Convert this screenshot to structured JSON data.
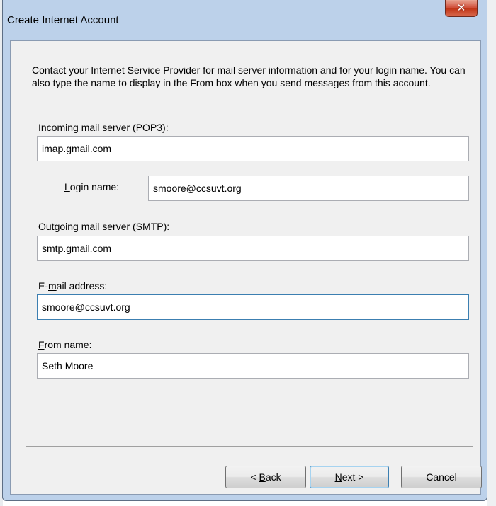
{
  "window": {
    "title": "Create Internet Account",
    "close_glyph": "✕"
  },
  "intro": "Contact your Internet Service Provider for mail server information and for your login name.  You can also type the name to display in the From box when you send messages from this account.",
  "incoming": {
    "label_key": "I",
    "label_rest": "ncoming mail server (POP3):",
    "value": "imap.gmail.com"
  },
  "login": {
    "label_key": "L",
    "label_rest": "ogin name:",
    "value": "smoore@ccsuvt.org"
  },
  "outgoing": {
    "label_key": "O",
    "label_rest": "utgoing mail server (SMTP):",
    "value": "smtp.gmail.com"
  },
  "email": {
    "label_pre": "E-",
    "label_key": "m",
    "label_rest": "ail address:",
    "value": "smoore@ccsuvt.org"
  },
  "from": {
    "label_key": "F",
    "label_rest": "rom name:",
    "value": "Seth Moore"
  },
  "buttons": {
    "back_pre": "< ",
    "back_key": "B",
    "back_rest": "ack",
    "next_key": "N",
    "next_rest": "ext >",
    "cancel": "Cancel"
  }
}
